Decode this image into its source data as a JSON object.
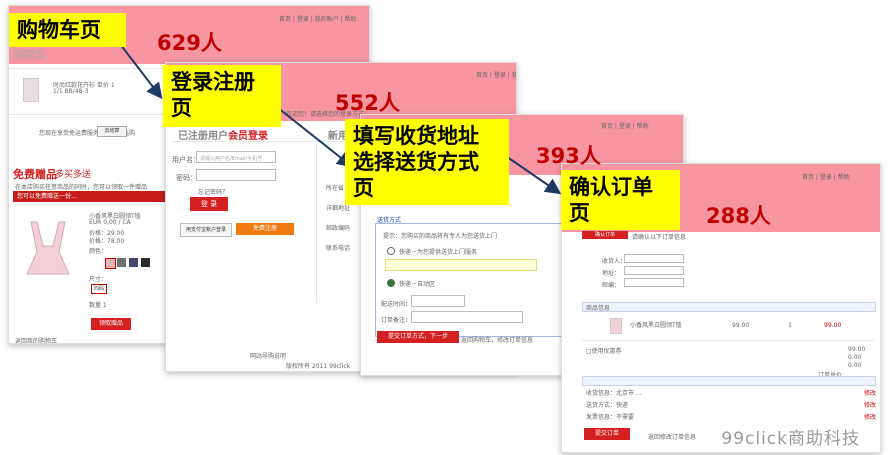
{
  "steps": [
    {
      "label": "购物车页",
      "count": "629人"
    },
    {
      "label": "登录注册\n页",
      "count": "552人"
    },
    {
      "label": "填写收货地址\n选择送货方式\n页",
      "count": "393人"
    },
    {
      "label": "确认订单\n页",
      "count": "288人"
    }
  ],
  "cart_page": {
    "heading": "购物车",
    "promo_title": "免费赠品",
    "promo_sub": "多买多送",
    "promo_bar": "您可以免费赠送一份...",
    "sizes_label": "尺寸：",
    "buy_btn": "领取赠品",
    "checkout_btn": "去结算"
  },
  "login_page": {
    "heading_gray": "已注册用户",
    "heading_red": "会员登录",
    "new_user": "新用户",
    "user_label": "用户名：",
    "user_placeholder": "请输入用户名/Email/手机号",
    "pwd_label": "密码：",
    "forgot": "忘记密码？",
    "login_btn": "登 录",
    "footer": "网站导购说明"
  },
  "address_page": {
    "tab": "送货方式",
    "option1": "快递－为您提供送货上门服务",
    "option2": "快递－自动区",
    "submit_btn": "提交订单方式，下一步"
  },
  "confirm_page": {
    "section": "商品信息",
    "submit_btn": "提交订单",
    "price1": "99.00",
    "price2": "99.00"
  },
  "watermark": "99click商助科技",
  "colors": {
    "band": "#f57887",
    "step_box": "#ffff00",
    "count": "#c00000",
    "arrow": "#1f3864",
    "button_red": "#d42020"
  }
}
